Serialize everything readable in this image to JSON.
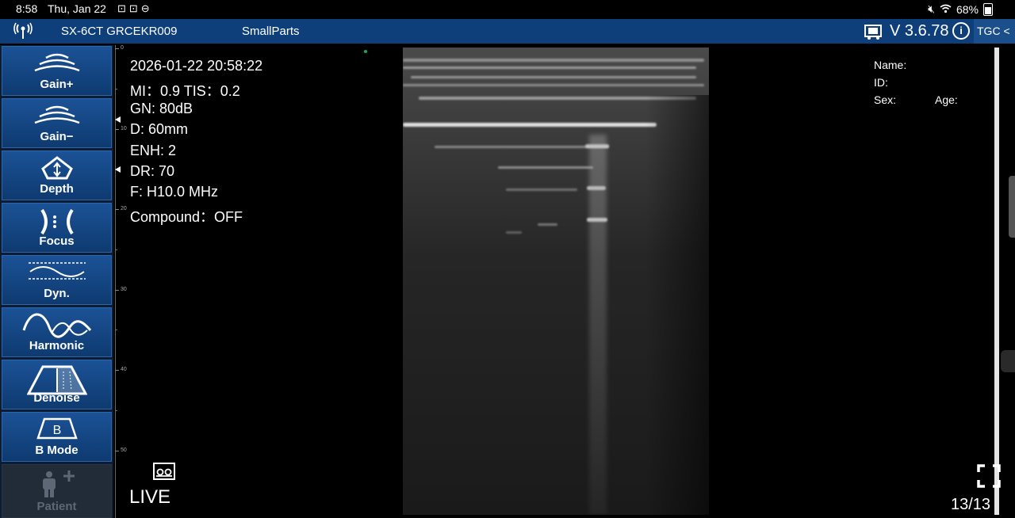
{
  "status_bar": {
    "time": "8:58",
    "date": "Thu, Jan 22",
    "battery": "68%"
  },
  "header": {
    "device": "SX-6CT GRCEKR009",
    "preset": "SmallParts",
    "version": "V 3.6.78",
    "info_label": "i",
    "tgc_label": "TGC <"
  },
  "sidebar": {
    "items": [
      {
        "label": "Gain+"
      },
      {
        "label": "Gain−"
      },
      {
        "label": "Depth"
      },
      {
        "label": "Focus"
      },
      {
        "label": "Dyn."
      },
      {
        "label": "Harmonic"
      },
      {
        "label": "Denoise"
      },
      {
        "label": "B Mode",
        "icon_text": "B"
      },
      {
        "label": "Patient"
      }
    ]
  },
  "ruler": {
    "ticks": [
      "0",
      "10",
      "20",
      "30",
      "40",
      "50"
    ]
  },
  "params": {
    "datetime": "2026-01-22 20:58:22",
    "mi_tis": "MI：0.9  TIS：0.2",
    "gain": "GN: 80dB",
    "depth": "D: 60mm",
    "enh": "ENH: 2",
    "dr": "DR: 70",
    "freq": "F: H10.0 MHz",
    "compound": "Compound：OFF"
  },
  "mode_state": "LIVE",
  "patient": {
    "name_label": "Name:",
    "id_label": "ID:",
    "sex_label": "Sex:",
    "age_label": "Age:"
  },
  "frame_counter": "13/13",
  "colors": {
    "header_bg": "#0f3f7a",
    "button_bg": "#1b5296",
    "status_dot": "#18a85a"
  }
}
